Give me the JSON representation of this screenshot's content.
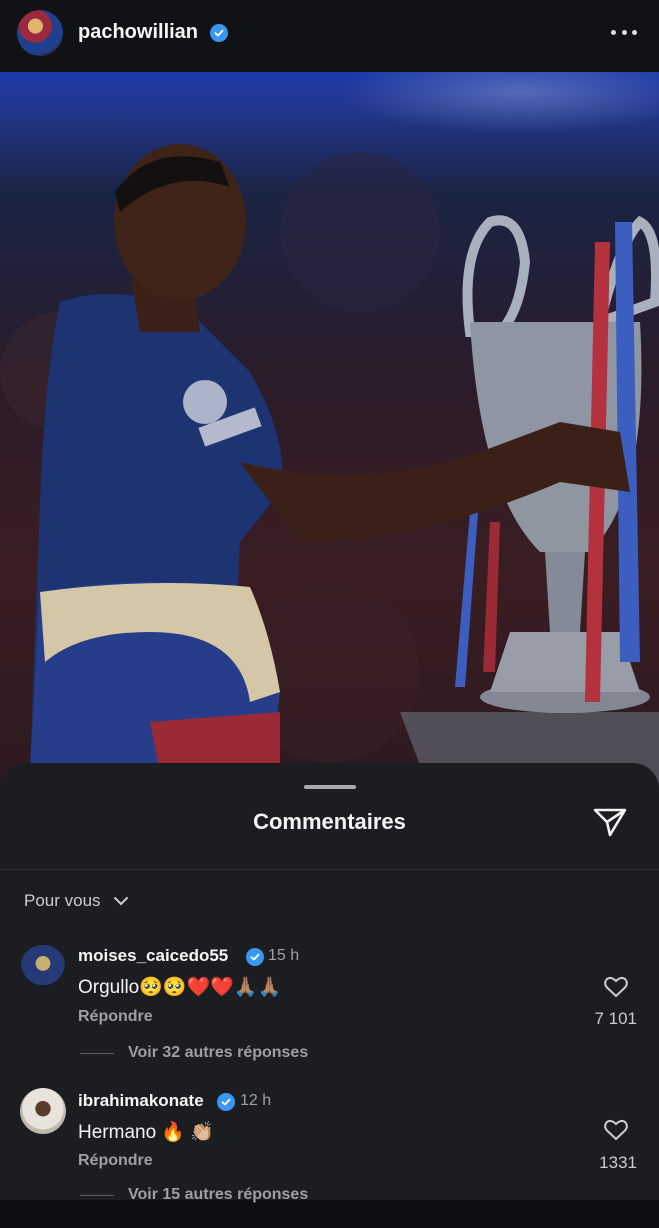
{
  "post": {
    "username": "pachowillian",
    "verified": true
  },
  "sheet": {
    "title": "Commentaires",
    "filter_label": "Pour vous"
  },
  "comments": [
    {
      "username": "moises_caicedo55",
      "time": "15 h",
      "text": "Orgullo🥺🥺❤️❤️🙏🏽🙏🏽",
      "reply_label": "Répondre",
      "likes": "7 101",
      "more_replies": "Voir 32 autres réponses"
    },
    {
      "username": "ibrahimakonate",
      "time": "12 h",
      "text": "Hermano 🔥 👏🏼",
      "reply_label": "Répondre",
      "likes": "1331",
      "more_replies": "Voir 15 autres réponses"
    }
  ],
  "colors": {
    "background": "#0c0e12",
    "sheet": "#1b1d21",
    "verified": "#3897f0",
    "muted_text": "#9ca0a6"
  }
}
